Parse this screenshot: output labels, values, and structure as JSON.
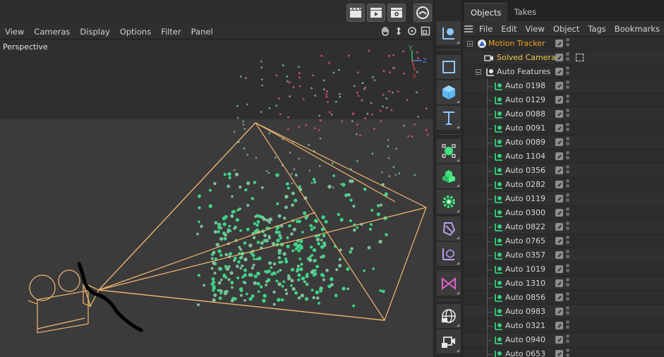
{
  "viewport": {
    "menu": [
      "View",
      "Cameras",
      "Display",
      "Options",
      "Filter",
      "Panel"
    ],
    "label": "Perspective",
    "axes": {
      "x": "X",
      "y": "Y",
      "z": "Z"
    }
  },
  "top_buttons": [
    "render-view-icon",
    "render-active-icon",
    "render-settings-icon",
    "interactive-render-icon"
  ],
  "toolbar_icons": [
    "live-selection-icon",
    "cube-outline-icon",
    "cube-icon",
    "text-icon",
    "pen-spline-icon",
    "cloner-icon",
    "gear-effector-icon",
    "deformer-icon",
    "null-axis-icon",
    "scene-mograph-icon",
    "globe-icon",
    "camera-tracker-icon"
  ],
  "objects_panel": {
    "tabs": [
      "Objects",
      "Takes"
    ],
    "menu": [
      "File",
      "Edit",
      "View",
      "Object",
      "Tags",
      "Bookmarks"
    ],
    "rows": [
      {
        "name": "Motion Tracker",
        "level": 0,
        "kind": "tracker"
      },
      {
        "name": "Solved Camera",
        "level": 1,
        "kind": "camera"
      },
      {
        "name": "Auto Features",
        "level": 1,
        "kind": "folder"
      },
      {
        "name": "Auto 0198",
        "level": 2,
        "kind": "feature"
      },
      {
        "name": "Auto 0129",
        "level": 2,
        "kind": "feature"
      },
      {
        "name": "Auto 0088",
        "level": 2,
        "kind": "feature"
      },
      {
        "name": "Auto 0091",
        "level": 2,
        "kind": "feature"
      },
      {
        "name": "Auto 0089",
        "level": 2,
        "kind": "feature"
      },
      {
        "name": "Auto 1104",
        "level": 2,
        "kind": "feature"
      },
      {
        "name": "Auto 0356",
        "level": 2,
        "kind": "feature"
      },
      {
        "name": "Auto 0282",
        "level": 2,
        "kind": "feature"
      },
      {
        "name": "Auto 0119",
        "level": 2,
        "kind": "feature"
      },
      {
        "name": "Auto 0300",
        "level": 2,
        "kind": "feature"
      },
      {
        "name": "Auto 0822",
        "level": 2,
        "kind": "feature"
      },
      {
        "name": "Auto 0765",
        "level": 2,
        "kind": "feature"
      },
      {
        "name": "Auto 0357",
        "level": 2,
        "kind": "feature"
      },
      {
        "name": "Auto 1019",
        "level": 2,
        "kind": "feature"
      },
      {
        "name": "Auto 1310",
        "level": 2,
        "kind": "feature"
      },
      {
        "name": "Auto 0856",
        "level": 2,
        "kind": "feature"
      },
      {
        "name": "Auto 0983",
        "level": 2,
        "kind": "feature"
      },
      {
        "name": "Auto 0321",
        "level": 2,
        "kind": "feature"
      },
      {
        "name": "Auto 0940",
        "level": 2,
        "kind": "feature"
      },
      {
        "name": "Auto 0653",
        "level": 2,
        "kind": "feature"
      }
    ]
  },
  "colors": {
    "tracker_text": "#f0a020",
    "camera_text": "#f3c84a",
    "feature_icon": "#34d07a",
    "frustum": "#f2b870",
    "point_green": "#3ed486",
    "point_red": "#c04a64"
  }
}
